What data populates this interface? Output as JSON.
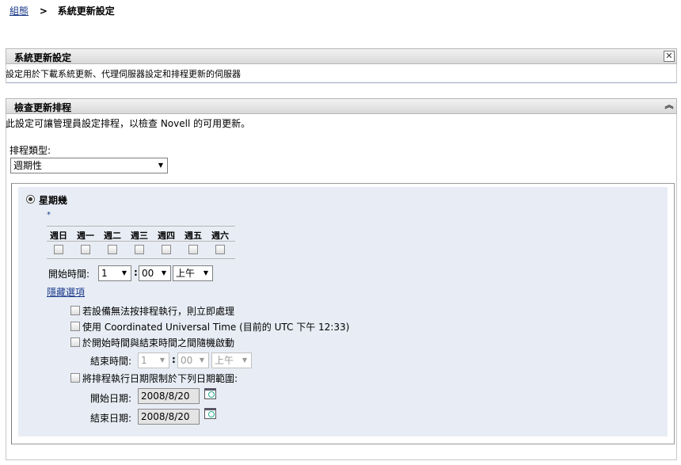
{
  "breadcrumb": {
    "parent": "組態",
    "separator": ">",
    "current": "系統更新設定"
  },
  "panel1": {
    "title": "系統更新設定",
    "description": "設定用於下載系統更新、代理伺服器設定和排程更新的伺服器",
    "close_glyph": "✕"
  },
  "panel2": {
    "title": "檢查更新排程",
    "description": "此設定可讓管理員設定排程，以檢查 Novell 的可用更新。",
    "collapse_glyph": "︽"
  },
  "schedule": {
    "type_label": "排程類型:",
    "type_value": "週期性"
  },
  "weekly": {
    "radio_label": "星期幾",
    "required_marker": "*",
    "days": [
      "週日",
      "週一",
      "週二",
      "週三",
      "週四",
      "週五",
      "週六"
    ],
    "start_time_label": "開始時間:",
    "start_hour": "1",
    "time_colon": ":",
    "start_minute": "00",
    "start_ampm": "上午",
    "hide_options_link": "隱藏選項",
    "options": {
      "run_immediately": "若設備無法按排程執行，則立即處理",
      "use_utc": "使用 Coordinated Universal Time (目前的 UTC 下午 12:33)",
      "random_start": "於開始時間與結束時間之間隨機啟動",
      "limit_dates": "將排程執行日期限制於下列日期範圍:"
    },
    "end_time_label": "結束時間:",
    "end_hour": "1",
    "end_minute": "00",
    "end_ampm": "上午",
    "start_date_label": "開始日期:",
    "start_date": "2008/8/20",
    "end_date_label": "結束日期:",
    "end_date": "2008/8/20"
  },
  "icons": {
    "dropdown": "dropdown-arrow-icon",
    "calendar": "calendar-icon",
    "close": "close-icon",
    "collapse": "collapse-icon"
  }
}
